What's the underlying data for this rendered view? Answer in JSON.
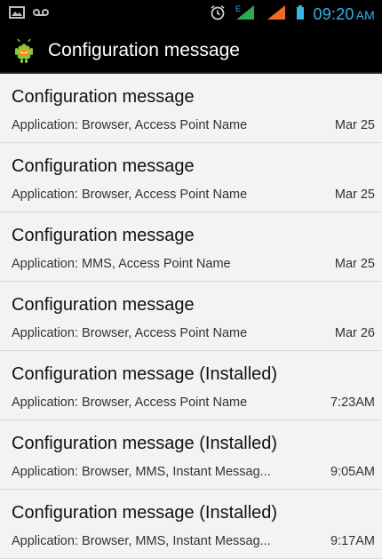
{
  "status_bar": {
    "time": "09:20",
    "ampm": "AM",
    "network_label": "E",
    "accent_color": "#33b5e5",
    "icons": [
      "gallery-icon",
      "voicemail-icon",
      "alarm-icon",
      "signal-icon",
      "battery-icon"
    ]
  },
  "action_bar": {
    "title": "Configuration message",
    "icon": "android-icon"
  },
  "messages": [
    {
      "title": "Configuration message",
      "subtitle": "Application: Browser, Access Point Name",
      "date": "Mar 25"
    },
    {
      "title": "Configuration message",
      "subtitle": "Application: Browser, Access Point Name",
      "date": "Mar 25"
    },
    {
      "title": "Configuration message",
      "subtitle": "Application: MMS, Access Point Name",
      "date": "Mar 25"
    },
    {
      "title": "Configuration message",
      "subtitle": "Application: Browser, Access Point Name",
      "date": "Mar 26"
    },
    {
      "title": "Configuration message (Installed)",
      "subtitle": "Application: Browser, Access Point Name",
      "date": "7:23AM"
    },
    {
      "title": "Configuration message (Installed)",
      "subtitle": "Application: Browser, MMS, Instant Messag...",
      "date": "9:05AM"
    },
    {
      "title": "Configuration message (Installed)",
      "subtitle": "Application: Browser, MMS, Instant Messag...",
      "date": "9:17AM"
    }
  ]
}
